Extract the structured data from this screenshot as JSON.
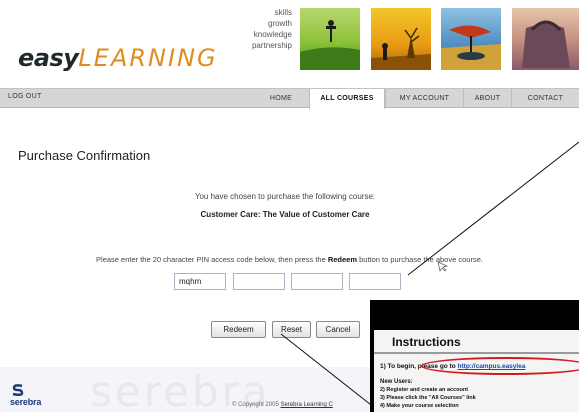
{
  "header": {
    "logo_bold": "easy",
    "logo_thin": "LEARNING",
    "tagline": [
      "skills",
      "growth",
      "knowledge",
      "partnership"
    ]
  },
  "nav": {
    "logout": "LOG OUT",
    "items": [
      "HOME",
      "ALL COURSES",
      "MY ACCOUNT",
      "ABOUT",
      "CONTACT"
    ],
    "active": "ALL COURSES"
  },
  "main": {
    "title": "Purchase Confirmation",
    "intro": "You have chosen to purchase the following course:",
    "course": "Customer Care: The Value of Customer Care",
    "pin_before": "Please enter the 20 character PIN access code below, then press the ",
    "pin_bold": "Redeem",
    "pin_after": " button to purchase the above course.",
    "pin_fields": [
      "mqhm",
      "",
      "",
      ""
    ],
    "buttons": {
      "redeem": "Redeem",
      "reset": "Reset",
      "cancel": "Cancel"
    }
  },
  "footer": {
    "brand": "serebra",
    "watermark": "serebra",
    "copyright_prefix": "© Copyright 2005 ",
    "copyright_link": "Serebra Learning C"
  },
  "popup": {
    "title": "Instructions",
    "step1_prefix": "1) To begin, please go to ",
    "step1_url": "http://campus.easylea",
    "new_users": "New Users:",
    "step2": "2) Register and create an account",
    "step3": "3) Please click the \"All Courses\" link",
    "step4": "4) Make your course selection"
  },
  "colors": {
    "logo_accent": "#e08c1e",
    "nav_bg": "#d6d6d6",
    "callout_oval": "#d21c1c",
    "link": "#1c49a8"
  }
}
